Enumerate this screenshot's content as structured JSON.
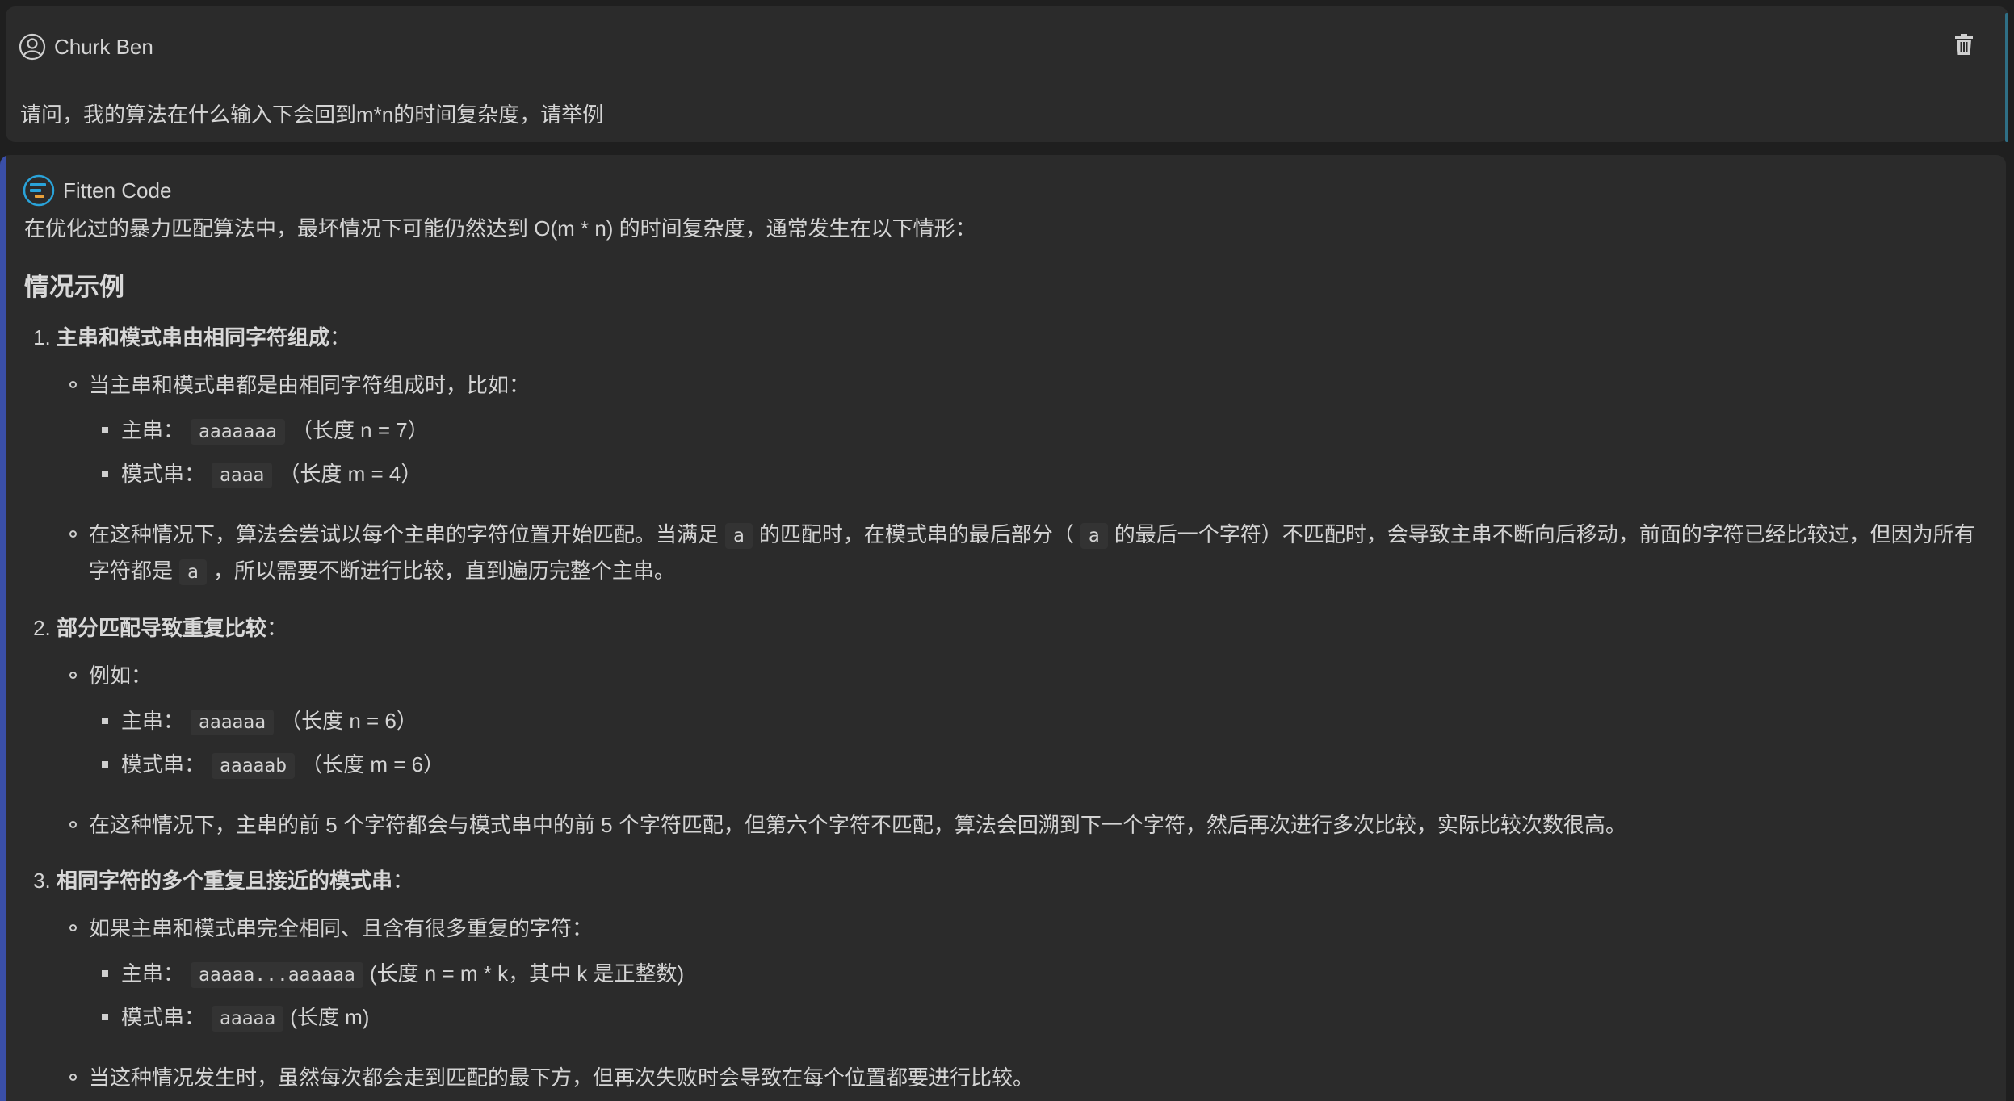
{
  "user": {
    "name": "Churk Ben",
    "message": "请问，我的算法在什么输入下会回到m*n的时间复杂度，请举例"
  },
  "assistant": {
    "name": "Fitten Code",
    "intro": "在优化过的暴力匹配算法中，最坏情况下可能仍然达到 O(m * n) 的时间复杂度，通常发生在以下情形：",
    "heading": "情况示例",
    "items": [
      {
        "title": "主串和模式串由相同字符组成",
        "title_suffix": "：",
        "b1": "当主串和模式串都是由相同字符组成时，比如：",
        "e1_label": "主串：",
        "e1_code": "aaaaaaa",
        "e1_note": "（长度 n = 7）",
        "e2_label": "模式串：",
        "e2_code": "aaaa",
        "e2_note": "（长度 m = 4）",
        "b2_part1": "在这种情况下，算法会尝试以每个主串的字符位置开始匹配。当满足",
        "b2_code1": "a",
        "b2_part2": "的匹配时，在模式串的最后部分（",
        "b2_code2": "a",
        "b2_part3": "的最后一个字符）不匹配时，会导致主串不断向后移动，前面的字符已经比较过，但因为所有字符都是",
        "b2_code3": "a",
        "b2_part4": "，所以需要不断进行比较，直到遍历完整个主串。"
      },
      {
        "title": "部分匹配导致重复比较",
        "title_suffix": "：",
        "b1": "例如：",
        "e1_label": "主串：",
        "e1_code": "aaaaaa",
        "e1_note": "（长度 n = 6）",
        "e2_label": "模式串：",
        "e2_code": "aaaaab",
        "e2_note": "（长度 m = 6）",
        "b2": "在这种情况下，主串的前 5 个字符都会与模式串中的前 5 个字符匹配，但第六个字符不匹配，算法会回溯到下一个字符，然后再次进行多次比较，实际比较次数很高。"
      },
      {
        "title": "相同字符的多个重复且接近的模式串",
        "title_suffix": "：",
        "b1": "如果主串和模式串完全相同、且含有很多重复的字符：",
        "e1_label": "主串：",
        "e1_code": "aaaaa...aaaaaa",
        "e1_note": "(长度 n = m * k，其中 k 是正整数)",
        "e2_label": "模式串：",
        "e2_code": "aaaaa",
        "e2_note": "(长度 m)",
        "b2": "当这种情况发生时，虽然每次都会走到匹配的最下方，但再次失败时会导致在每个位置都要进行比较。"
      }
    ]
  },
  "icons": {
    "user": "user-circle-icon",
    "trash": "trash-icon",
    "assistant": "fitten-code-logo-icon"
  },
  "colors": {
    "background": "#1f1f1f",
    "card": "#2b2b2b",
    "accent_user": "#2f6f86",
    "accent_assistant": "#3a4fa8",
    "logo": "#2aa3d9"
  }
}
